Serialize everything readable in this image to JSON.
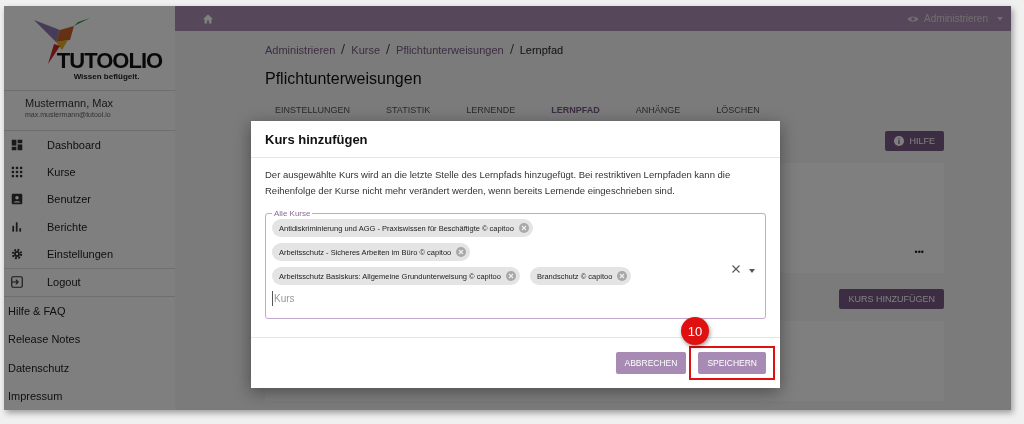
{
  "sidebar": {
    "logo": {
      "name": "TUTOOLIO",
      "tagline": "Wissen beflügelt."
    },
    "user": {
      "name": "Mustermann, Max",
      "email": "max.mustermann@tutool.io"
    },
    "nav_items": [
      {
        "label": "Dashboard"
      },
      {
        "label": "Kurse"
      },
      {
        "label": "Benutzer"
      },
      {
        "label": "Berichte"
      },
      {
        "label": "Einstellungen"
      },
      {
        "label": "Logout"
      }
    ],
    "links": [
      "Hilfe & FAQ",
      "Release Notes",
      "Datenschutz",
      "Impressum"
    ]
  },
  "top_bar": {
    "role_menu": "Administrieren"
  },
  "breadcrumb": [
    {
      "label": "Administrieren",
      "link": true
    },
    {
      "label": "Kurse",
      "link": true
    },
    {
      "label": "Pflichtunterweisungen",
      "link": true
    },
    {
      "label": "Lernpfad",
      "link": false
    }
  ],
  "page_title": "Pflichtunterweisungen",
  "tabs": [
    {
      "label": "EINSTELLUNGEN",
      "selected": false
    },
    {
      "label": "STATISTIK",
      "selected": false
    },
    {
      "label": "LERNENDE",
      "selected": false
    },
    {
      "label": "LERNPFAD",
      "selected": true
    },
    {
      "label": "ANHÄNGE",
      "selected": false
    },
    {
      "label": "LÖSCHEN",
      "selected": false
    }
  ],
  "help_button": "HILFE",
  "more_menu": "•••",
  "add_course_button": "KURS HINZUFÜGEN",
  "dialog": {
    "title": "Kurs hinzufügen",
    "text": "Der ausgewählte Kurs wird an die letzte Stelle des Lernpfads hinzugefügt. Bei restriktiven Lernpfaden kann die Reihenfolge der Kurse nicht mehr verändert werden, wenn bereits Lernende eingeschrieben sind.",
    "field": {
      "label": "Alle Kurse",
      "placeholder": "Kurs",
      "chips": [
        [
          "Antidiskriminierung und AGG - Praxiswissen für Beschäftigte © capitoo"
        ],
        [
          "Arbeitsschutz - Sicheres Arbeiten im Büro © capitoo"
        ],
        [
          "Arbeitsschutz Basiskurs: Allgemeine Grundunterweisung © capitoo",
          "Brandschutz © capitoo"
        ]
      ]
    },
    "buttons": [
      {
        "label": "ABBRECHEN",
        "highlighted": false
      },
      {
        "label": "SPEICHERN",
        "highlighted": true
      }
    ]
  },
  "step_badge": "10"
}
